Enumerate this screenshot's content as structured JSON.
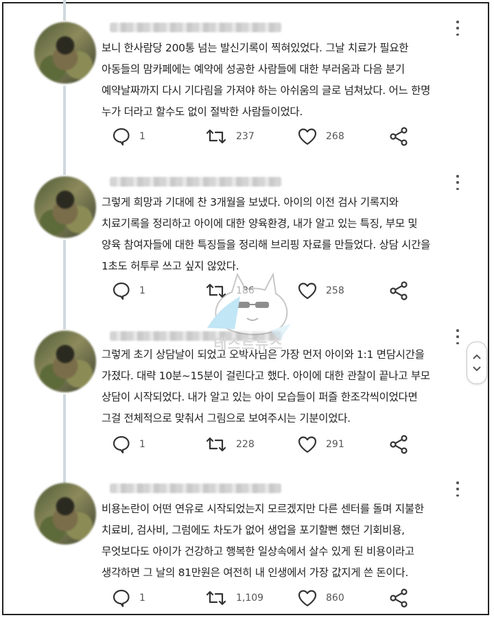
{
  "tweets": [
    {
      "text": "보니 한사람당 200통 넘는 발신기록이 찍혀있었다. 그날 치료가 필요한\n아동들의 맘카페에는 예약에 성공한 사람들에 대한 부러움과 다음 분기\n예약날짜까지 다시 기다림을 가져야 하는 아쉬움의 글로 넘쳐났다. 어느 한명\n누가 더라고 할수도 없이 절박한 사람들이었다.",
      "replies": "1",
      "retweets": "237",
      "likes": "268"
    },
    {
      "text": "그렇게 희망과 기대에 찬 3개월을 보냈다. 아이의 이전 검사 기록지와\n치료기록을 정리하고 아이에 대한 양육환경, 내가 알고 있는 특징, 부모 및\n양육 참여자들에 대한 특징들을 정리해 브리핑 자료를 만들었다. 상담 시간을\n1초도 허투루 쓰고 싶지 않았다.",
      "replies": "1",
      "retweets": "186",
      "likes": "258"
    },
    {
      "text": "그렇게 초기 상담날이 되었고 오박사님은 가장 먼저 아이와 1:1 면담시간을\n가졌다. 대략 10분~15분이 걸린다고 했다. 아이에 대한 관찰이 끝나고 부모\n상담이 시작되었다. 내가 알고 있는 아이 모습들이 퍼즐 한조각씩이었다면\n그걸 전체적으로 맞춰서 그림으로 보여주시는 기분이었다.",
      "replies": "1",
      "retweets": "228",
      "likes": "291"
    },
    {
      "text": "비용논란이 어떤 연유로 시작되었는지 모르겠지만 다른 센터를 돌며 지불한\n치료비, 검사비, 그럼에도 차도가 없어 생업을 포기할뻔 했던 기회비용,\n무엇보다도 아이가 건강하고 행복한 일상속에서 살수 있게 된 비용이라고\n생각하면 그 날의 81만원은 여전히 내 인생에서 가장 값지게 쓴 돈이다.",
      "replies": "1",
      "retweets": "1,109",
      "likes": "860"
    }
  ],
  "icons": {
    "reply": "speech-bubble-icon",
    "retweet": "retweet-icon",
    "like": "heart-icon",
    "share": "share-icon",
    "more": "more-vertical-icon",
    "scroll": "scroll-arrows-icon"
  },
  "watermark": {
    "text": "테스트뉴스"
  },
  "colors": {
    "icon": "#333333",
    "count": "#555555",
    "thread": "#cfd9de",
    "watermark": "#8fd3ee"
  }
}
